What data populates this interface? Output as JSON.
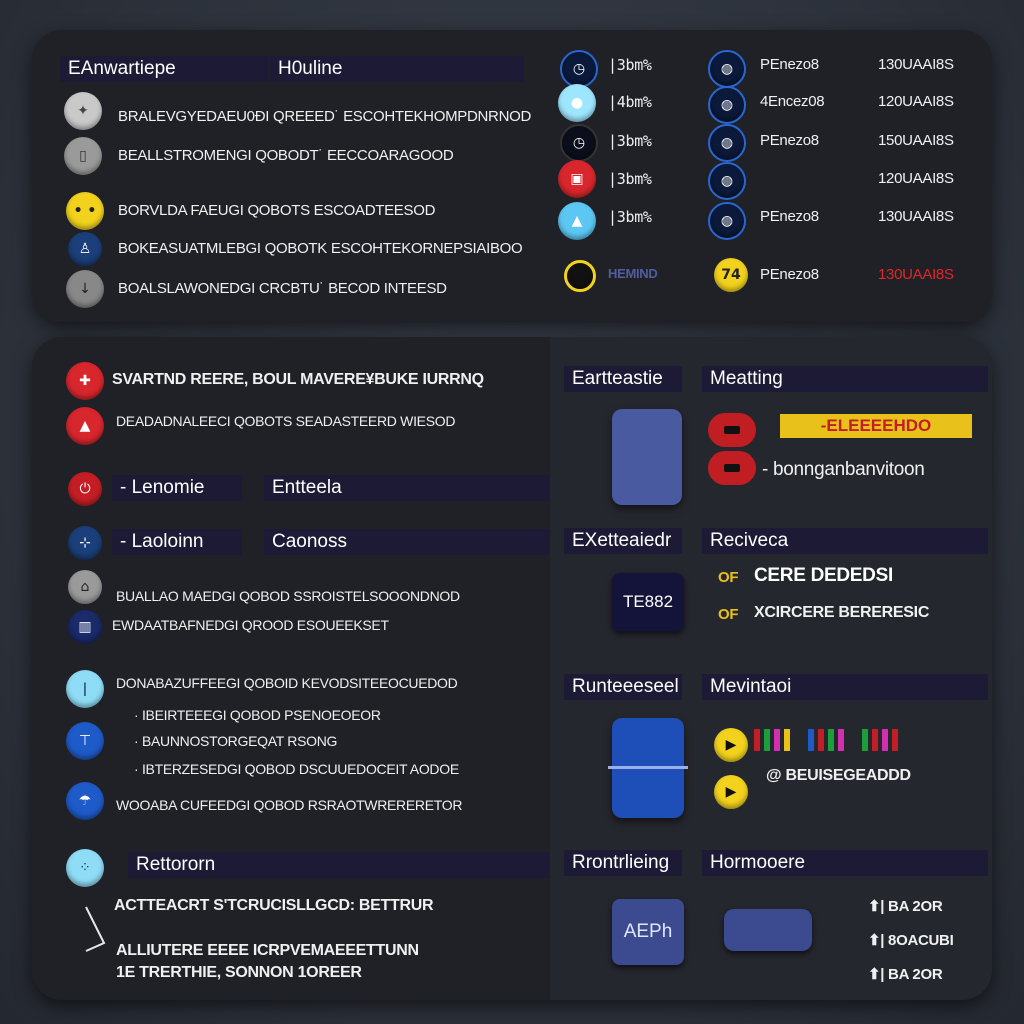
{
  "top": {
    "header_left": "EAnwartiepe",
    "header_right": "H0uline",
    "rows": [
      "BRALEVGYEDAEU0ĐI QREEED˙ ESCOHTEKHOMPDNRNOD",
      "BEALLSTROMENGI QOBODT˙ EECCOARAGOOD",
      "BORVLDA FAEUGI QOBOTS  ESCOADTEESOD",
      "BOKEASUATMLEBGI QOBOTK  ESCOHTEKORNEPSIAIBOO",
      "BOALSLAWONEDGI CRCBTU˙ BECOD INTEESD"
    ],
    "status": [
      {
        "c1": "|3bm%",
        "c2": "PEnezo8",
        "c3": "130UAAI8S"
      },
      {
        "c1": "|4bm%",
        "c2": "4Encez08",
        "c3": "120UAAI8S"
      },
      {
        "c1": "|3bm%",
        "c2": "PEnezo8",
        "c3": "150UAAI8S"
      },
      {
        "c1": "|3bm%",
        "c2": "",
        "c3": "120UAAI8S"
      },
      {
        "c1": "|3bm%",
        "c2": "PEnezo8",
        "c3": "130UAAI8S"
      },
      {
        "c1": "HEMIND",
        "c2": "PEnezo8",
        "c3": "130UAAI8S"
      }
    ]
  },
  "bottom": {
    "row1": "SVARTND REERE, BOUL MAVERE¥BUKE IURRNQ",
    "row2": "DEADADNALEECI QOBOTS  SEADASTEERD WIESOD",
    "lenomie": "- Lenomie",
    "entteela": "Entteela",
    "laoloinn": "- Laoloinn",
    "caonoss": "Caonoss",
    "row3": "BUALLAO MAEDGI QOBOD  SSROISTELSOOONDNOD",
    "row4": "EWDAATBAFNEDGI QROOD   ESOUEEKSET",
    "row5": "DONABAZUFFEEGI QOBOID  KEVODSITEEOCUEDOD",
    "row6": "· IBEIRTEEEGI QOBOD  PSENOEOEOR",
    "row7": "· BAUNNOSTORGEQAT  RSONG",
    "row8": "· IBTERZESEDGI QOBOD   DSCUUEDOCEIT AODOE",
    "row9": "WOOABA CUFEEDGI QOBOD  RSRAOTWRERERETOR",
    "rettororn": "Rettororn",
    "act1": "ACTTEACRT S'TCRUCISLLGCD: BETTRUR",
    "act2": "ALLIUTERE EEEE ICRPVEMAEEETTUNN",
    "act3": "1E TRERTHIE, SONNON  1OREER",
    "hdr_eartteastie": "Eartteastie",
    "hdr_meatting": "Meatting",
    "chip_text": "-ELEEEEHDO",
    "bong": "- bonnganbanvitoon",
    "hdr_exetteaiedr": "EXetteaiedr",
    "hdr_reciveca": "Reciveca",
    "te882": "TE882",
    "of1": "OF",
    "cer": "CERE DEDEDSI",
    "of2": "OF",
    "icr": "XCIRCERE BERERESIC",
    "hdr_runteeeseel": "Runteeeseel",
    "hdr_mevintaoi": "Mevintaoi",
    "beuse": "@ BEUISEGEADDD",
    "hdr_rrontrlieing": "Rrontrlieing",
    "hdr_hormooere": "Hormooere",
    "aeph": "AEPh",
    "ba1": "| BA 2OR",
    "ba2": "| 8OACUBI",
    "ba3": "| BA 2OR",
    "colors": {
      "red": "#d8262d",
      "yellow": "#f2d21d",
      "blue": "#1e5ac8",
      "cyan": "#3fc6ef",
      "navy": "#1d1a36"
    }
  }
}
